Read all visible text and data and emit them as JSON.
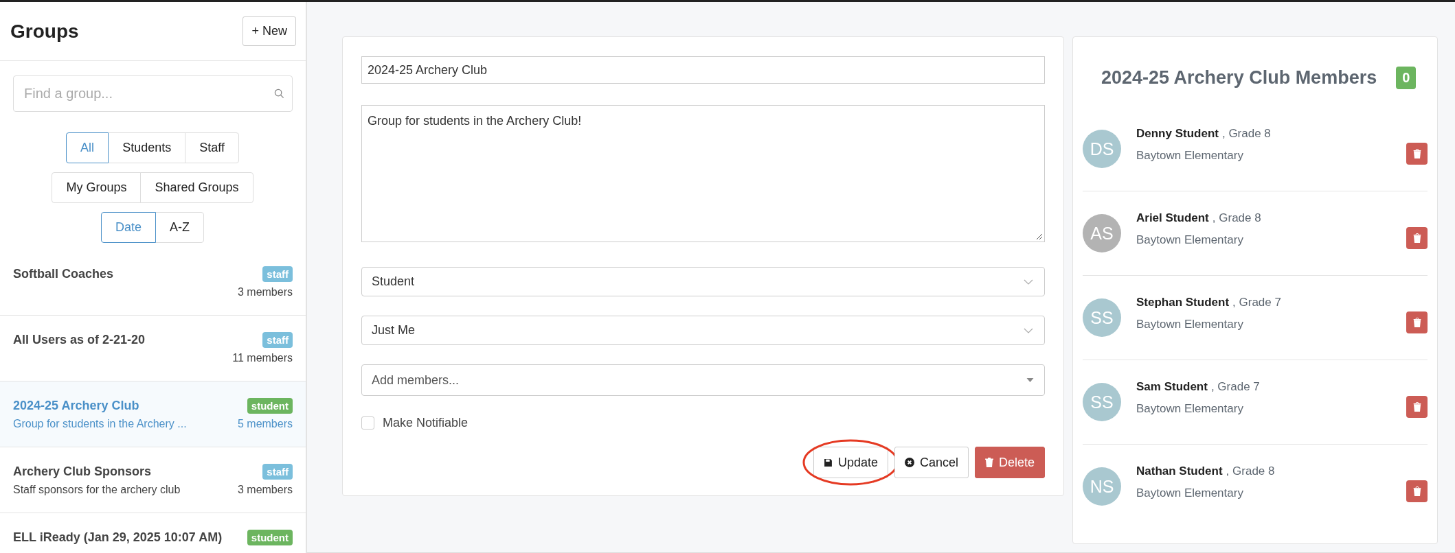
{
  "sidebar": {
    "title": "Groups",
    "new_button": "+ New",
    "search": {
      "placeholder": "Find a group..."
    },
    "filters": [
      [
        {
          "label": "All",
          "selected": true
        },
        {
          "label": "Students",
          "selected": false
        },
        {
          "label": "Staff",
          "selected": false
        }
      ],
      [
        {
          "label": "My Groups",
          "selected": false
        },
        {
          "label": "Shared Groups",
          "selected": false
        }
      ],
      [
        {
          "label": "Date",
          "selected": true
        },
        {
          "label": "A-Z",
          "selected": false
        }
      ]
    ],
    "groups": [
      {
        "name": "Softball Coaches",
        "tag": "staff",
        "color": "#7bbfdc",
        "members": "3 members",
        "selected": false
      },
      {
        "name": "All Users as of 2-21-20",
        "tag": "staff",
        "color": "#7bbfdc",
        "members": "11 members",
        "selected": false
      },
      {
        "name": "2024-25 Archery Club",
        "description": "Group for students in the Archery ...",
        "tag": "student",
        "color": "#6cb55f",
        "members": "5 members",
        "selected": true
      },
      {
        "name": "Archery Club Sponsors",
        "description": "Staff sponsors for the archery club",
        "tag": "staff",
        "color": "#7bbfdc",
        "members": "3 members",
        "selected": false
      },
      {
        "name": "ELL iReady (Jan 29, 2025 10:07 AM)",
        "tag": "student",
        "color": "#6cb55f",
        "selected": false
      }
    ]
  },
  "form": {
    "name": "2024-25 Archery Club",
    "description": "Group for students in the Archery Club!",
    "type_select": "Student",
    "share_select": "Just Me",
    "add_members": {
      "placeholder": "Add members..."
    },
    "notifiable": {
      "label": "Make Notifiable",
      "checked": false
    },
    "buttons": [
      {
        "label": "Update",
        "kind": "update",
        "highlighted": true
      },
      {
        "label": "Cancel",
        "kind": "cancel",
        "highlighted": false
      },
      {
        "label": "Delete",
        "kind": "delete",
        "highlighted": false
      }
    ]
  },
  "members_panel": {
    "title": "2024-25 Archery Club Members",
    "count": "0",
    "members": [
      {
        "initials": "DS",
        "color": "#a9c8d0",
        "name": "Denny Student",
        "grade": ", Grade 8",
        "school": "Baytown Elementary"
      },
      {
        "initials": "AS",
        "color": "#b3b3b3",
        "name": "Ariel Student",
        "grade": ", Grade 8",
        "school": "Baytown Elementary"
      },
      {
        "initials": "SS",
        "color": "#a9c8d0",
        "name": "Stephan Student",
        "grade": ", Grade 7",
        "school": "Baytown Elementary"
      },
      {
        "initials": "SS",
        "color": "#a9c8d0",
        "name": "Sam Student",
        "grade": ", Grade 7",
        "school": "Baytown Elementary"
      },
      {
        "initials": "NS",
        "color": "#a9c8d0",
        "name": "Nathan Student",
        "grade": ", Grade 8",
        "school": "Baytown Elementary"
      }
    ]
  }
}
